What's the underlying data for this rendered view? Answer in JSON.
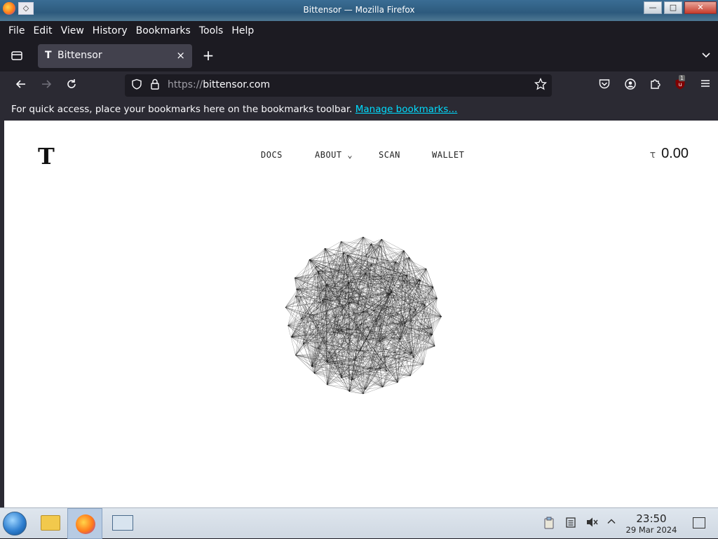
{
  "window": {
    "title": "Bittensor — Mozilla Firefox",
    "pin_symbol": "◇",
    "controls": [
      "—",
      "□",
      "✕"
    ]
  },
  "menu": [
    "File",
    "Edit",
    "View",
    "History",
    "Bookmarks",
    "Tools",
    "Help"
  ],
  "tab": {
    "favicon": "T",
    "title": "Bittensor",
    "close": "×",
    "new_tab": "+"
  },
  "navbar": {
    "url_scheme": "https://",
    "url_host": "bittensor.com",
    "ublock_count": "1"
  },
  "bookmarks_bar": {
    "message": "For quick access, place your bookmarks here on the bookmarks toolbar.",
    "link": "Manage bookmarks..."
  },
  "page": {
    "logo": "T",
    "nav": [
      "DOCS",
      "ABOUT",
      "SCAN",
      "WALLET"
    ],
    "about_caret": "⌄",
    "currency_symbol": "τ",
    "balance": "0.00"
  },
  "taskbar": {
    "time": "23:50",
    "date": "29 Mar 2024"
  },
  "colors": {
    "browser_bg": "#1c1b22",
    "toolbar_bg": "#2b2a33",
    "tab_bg": "#42414d",
    "link": "#00ddff",
    "page_bg": "#ffffff"
  }
}
